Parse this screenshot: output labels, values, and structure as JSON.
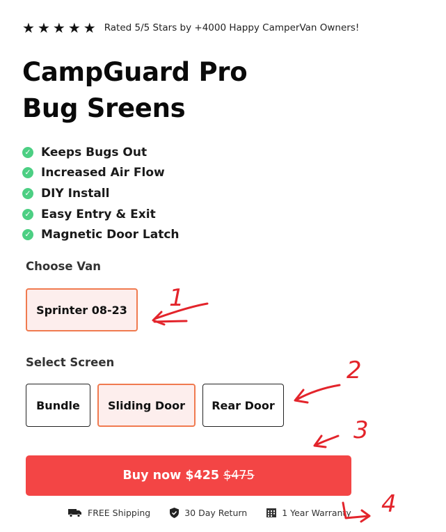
{
  "rating": {
    "stars": [
      "★",
      "★",
      "★",
      "★",
      "★"
    ],
    "text": "Rated 5/5 Stars by +4000 Happy CamperVan Owners!"
  },
  "product": {
    "title_line1": "CampGuard Pro",
    "title_line2": "Bug Sreens"
  },
  "features": [
    "Keeps Bugs Out",
    "Increased Air Flow",
    "DIY Install",
    "Easy Entry & Exit",
    "Magnetic Door Latch"
  ],
  "van": {
    "label": "Choose Van",
    "options": [
      {
        "label": "Sprinter 08-23",
        "selected": true
      }
    ]
  },
  "screen": {
    "label": "Select Screen",
    "options": [
      {
        "label": "Bundle",
        "selected": false
      },
      {
        "label": "Sliding Door",
        "selected": true
      },
      {
        "label": "Rear Door",
        "selected": false
      }
    ]
  },
  "buy": {
    "label": "Buy now",
    "price": "$425",
    "old_price": "$475"
  },
  "trust": [
    {
      "icon": "truck-icon",
      "text": "FREE Shipping"
    },
    {
      "icon": "shield-icon",
      "text": "30 Day Return"
    },
    {
      "icon": "calendar-icon",
      "text": "1 Year Warranty"
    }
  ],
  "annotations": [
    "1",
    "2",
    "3",
    "4"
  ],
  "colors": {
    "accent_red": "#f34545",
    "selected_border": "#f07a4f",
    "selected_bg": "#fdeeed",
    "check_green": "#4ccf83",
    "annotation_red": "#e3242b"
  }
}
